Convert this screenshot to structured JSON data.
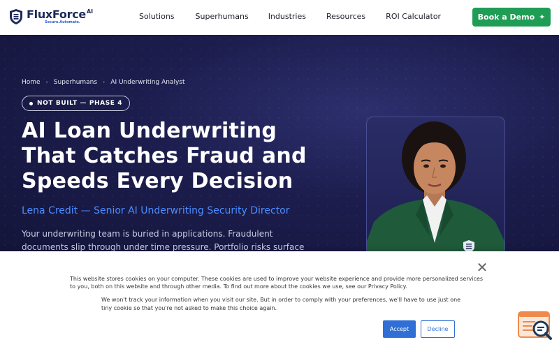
{
  "brand": {
    "name": "FluxForce",
    "ai_suffix": "AI",
    "tagline": "Secure.Automate.",
    "accent_color": "#1f9d55",
    "navy_color": "#1e2a5a"
  },
  "nav": {
    "items": [
      {
        "label": "Solutions"
      },
      {
        "label": "Superhumans"
      },
      {
        "label": "Industries"
      },
      {
        "label": "Resources"
      },
      {
        "label": "ROI Calculator"
      }
    ],
    "cta_label": "Book a Demo",
    "cta_icon": "sparkle-icon"
  },
  "hero": {
    "breadcrumb": [
      "Home",
      "Superhumans",
      "AI Underwriting Analyst"
    ],
    "badge": "NOT BUILT — PHASE 4",
    "headline_lines": [
      "AI Loan Underwriting",
      "That Catches Fraud and",
      "Speeds Every Decision"
    ],
    "subheadline": "Lena Credit — Senior AI Underwriting Security Director",
    "description": "Your underwriting team is buried in applications. Fraudulent documents slip through under time pressure. Portfolio risks surface months too late.",
    "subhead_color": "#4d8dff"
  },
  "cookie_banner": {
    "text_primary": "This website stores cookies on your computer. These cookies are used to improve your website experience and provide more personalized services to you, both on this website and through other media. To find out more about the cookies we use, see our Privacy Policy.",
    "text_secondary": "We won't track your information when you visit our site. But in order to comply with your preferences, we'll have to use just one tiny cookie so that you're not asked to make this choice again.",
    "accept_label": "Accept",
    "decline_label": "Decline",
    "button_color": "#2f6fd6"
  }
}
